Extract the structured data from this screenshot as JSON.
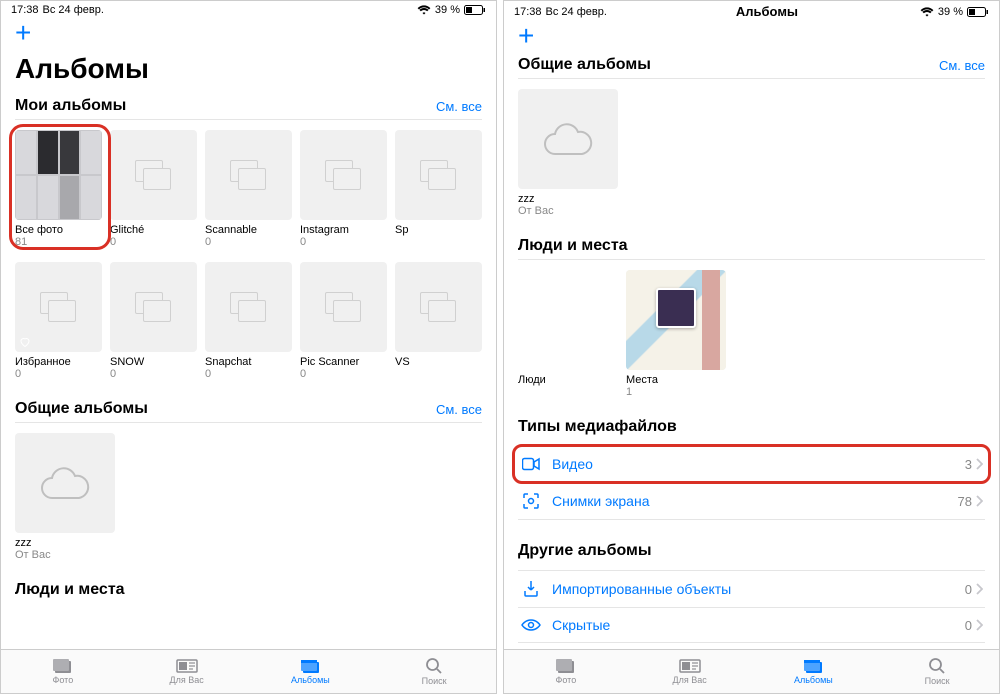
{
  "status": {
    "time": "17:38",
    "date": "Вс 24 февр.",
    "battery": "39 %"
  },
  "page_title": "Альбомы",
  "left": {
    "my_albums": {
      "title": "Мои альбомы",
      "see_all": "См. все"
    },
    "shared": {
      "title": "Общие альбомы",
      "see_all": "См. все"
    },
    "people_places": {
      "title": "Люди и места"
    },
    "albums_row1": [
      {
        "label": "Все фото",
        "count": "81"
      },
      {
        "label": "Glitché",
        "count": "0"
      },
      {
        "label": "Scannable",
        "count": "0"
      },
      {
        "label": "Instagram",
        "count": "0"
      },
      {
        "label": "Sp",
        "count": ""
      }
    ],
    "albums_row2": [
      {
        "label": "Избранное",
        "count": "0"
      },
      {
        "label": "SNOW",
        "count": "0"
      },
      {
        "label": "Snapchat",
        "count": "0"
      },
      {
        "label": "Pic Scanner",
        "count": "0"
      },
      {
        "label": "VS",
        "count": ""
      }
    ],
    "shared_album": {
      "label": "zzz",
      "sub": "От Вас"
    }
  },
  "right": {
    "shared": {
      "title": "Общие альбомы",
      "see_all": "См. все"
    },
    "shared_album": {
      "label": "zzz",
      "sub": "От Вас"
    },
    "people_places": {
      "title": "Люди и места"
    },
    "people": {
      "label": "Люди",
      "count": ""
    },
    "places": {
      "label": "Места",
      "count": "1"
    },
    "media_types": {
      "title": "Типы медиафайлов"
    },
    "other_albums": {
      "title": "Другие альбомы"
    },
    "media": {
      "video": {
        "label": "Видео",
        "count": "3"
      },
      "screens": {
        "label": "Снимки экрана",
        "count": "78"
      },
      "imported": {
        "label": "Импортированные объекты",
        "count": "0"
      },
      "hidden": {
        "label": "Скрытые",
        "count": "0"
      }
    }
  },
  "tabs": {
    "photos": "Фото",
    "foryou": "Для Вас",
    "albums": "Альбомы",
    "search": "Поиск"
  }
}
